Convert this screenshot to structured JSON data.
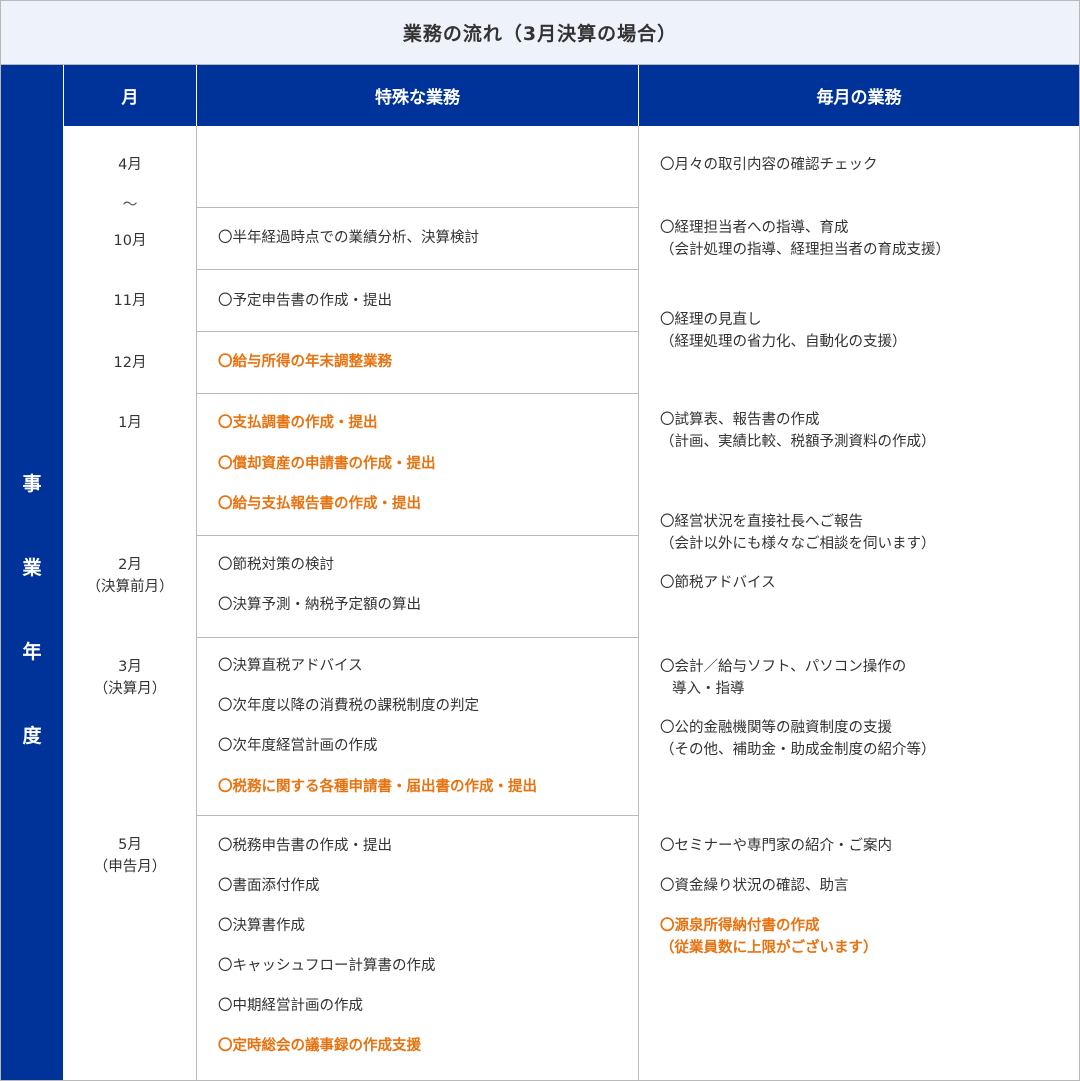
{
  "title": "業務の流れ（3月決算の場合）",
  "side_label": [
    "事",
    "業",
    "年",
    "度"
  ],
  "headers": {
    "month": "月",
    "special": "特殊な業務",
    "monthly": "毎月の業務"
  },
  "months": {
    "apr": "4月",
    "tilde": "～",
    "oct": "10月",
    "nov": "11月",
    "dec": "12月",
    "jan": "1月",
    "feb": "2月",
    "feb_sub": "（決算前月）",
    "mar": "3月",
    "mar_sub": "（決算月）",
    "may": "5月",
    "may_sub": "（申告月）"
  },
  "special": {
    "oct": [
      "〇半年経過時点での業績分析、決算検討"
    ],
    "nov": [
      "〇予定申告書の作成・提出"
    ],
    "dec": [
      "〇給与所得の年末調整業務"
    ],
    "jan": [
      "〇支払調書の作成・提出",
      "〇償却資産の申請書の作成・提出",
      "〇給与支払報告書の作成・提出"
    ],
    "feb": [
      "〇節税対策の検討",
      "〇決算予測・納税予定額の算出"
    ],
    "mar": [
      "〇決算直税アドバイス",
      "〇次年度以降の消費税の課税制度の判定",
      "〇次年度経営計画の作成",
      "〇税務に関する各種申請書・届出書の作成・提出"
    ],
    "may": [
      "〇税務申告書の作成・提出",
      "〇書面添付作成",
      "〇決算書作成",
      "〇キャッシュフロー計算書の作成",
      "〇中期経営計画の作成",
      "〇定時総会の議事録の作成支援"
    ]
  },
  "monthly": [
    "〇月々の取引内容の確認チェック",
    "〇経理担当者への指導、育成",
    "（会計処理の指導、経理担当者の育成支援）",
    "〇経理の見直し",
    "（経理処理の省力化、自動化の支援）",
    "〇試算表、報告書の作成",
    "（計画、実績比較、税額予測資料の作成）",
    "〇経営状況を直接社長へご報告",
    "（会計以外にも様々なご相談を伺います）",
    "〇節税アドバイス",
    "〇会計／給与ソフト、パソコン操作の",
    "導入・指導",
    "〇公的金融機関等の融資制度の支援",
    "（その他、補助金・助成金制度の紹介等）",
    "〇セミナーや専門家の紹介・ご案内",
    "〇資金繰り状況の確認、助言",
    "〇源泉所得納付書の作成",
    "（従業員数に上限がございます）"
  ],
  "colors": {
    "navy": "#003399",
    "orange": "#e67310",
    "title_bg": "#eef2fa",
    "border": "#b9b9b9",
    "text": "#333333"
  }
}
